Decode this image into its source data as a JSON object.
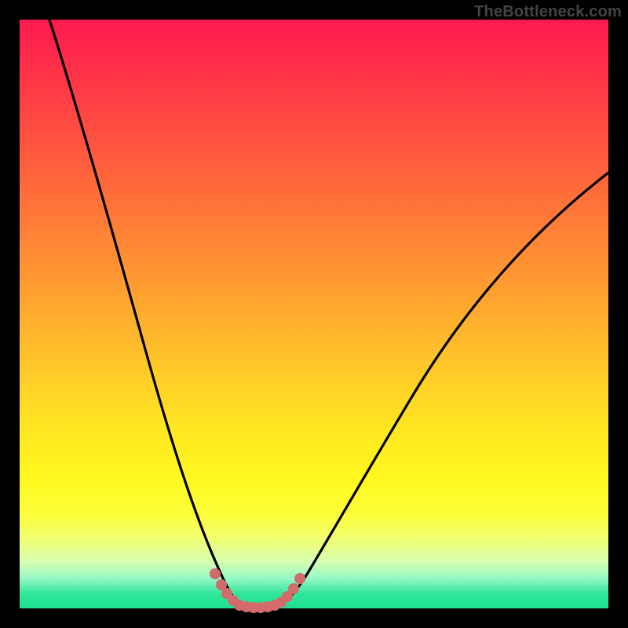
{
  "watermark": "TheBottleneck.com",
  "colors": {
    "frame": "#000000",
    "gradient_top": "#ff1a4f",
    "gradient_bottom": "#1ddf93",
    "curve": "#000000",
    "marker": "#d46b6b"
  },
  "chart_data": {
    "type": "line",
    "title": "",
    "xlabel": "",
    "ylabel": "",
    "xlim": [
      0,
      1
    ],
    "ylim": [
      0,
      1
    ],
    "series": [
      {
        "name": "bottleneck-curve",
        "x": [
          0.0,
          0.05,
          0.1,
          0.15,
          0.2,
          0.25,
          0.28,
          0.3,
          0.32,
          0.34,
          0.35,
          0.36,
          0.38,
          0.4,
          0.42,
          0.44,
          0.48,
          0.52,
          0.56,
          0.62,
          0.7,
          0.8,
          0.9,
          1.0
        ],
        "y": [
          1.0,
          0.86,
          0.7,
          0.54,
          0.38,
          0.22,
          0.13,
          0.08,
          0.04,
          0.02,
          0.008,
          0.003,
          0.003,
          0.003,
          0.006,
          0.015,
          0.05,
          0.1,
          0.17,
          0.27,
          0.4,
          0.55,
          0.67,
          0.74
        ]
      }
    ],
    "markers": {
      "name": "highlight-dots",
      "x": [
        0.315,
        0.325,
        0.335,
        0.345,
        0.355,
        0.365,
        0.375,
        0.385,
        0.395,
        0.405,
        0.415,
        0.425,
        0.435,
        0.445
      ],
      "y": [
        0.048,
        0.03,
        0.016,
        0.008,
        0.004,
        0.002,
        0.002,
        0.002,
        0.003,
        0.004,
        0.008,
        0.014,
        0.024,
        0.04
      ]
    }
  }
}
